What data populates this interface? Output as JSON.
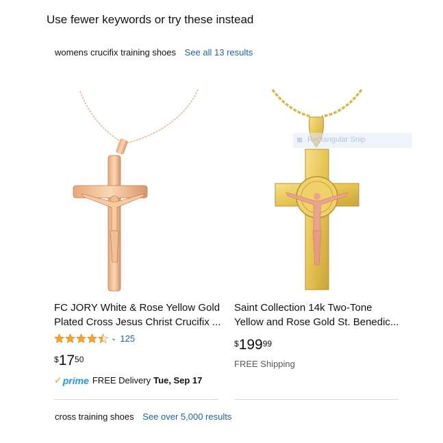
{
  "header": {
    "title": "Use fewer keywords or try these instead"
  },
  "suggestions": [
    {
      "term": "womens crucifix training shoes",
      "link": "See all 13 results"
    },
    {
      "term": "cross training shoes",
      "link": "See over 5,000 results"
    }
  ],
  "products": [
    {
      "title_line1": "FC JORY White & Rose Yellow Gold",
      "title_line2": "Plated Cross Jesus Christ Crucifix ...",
      "rating_stars": 4.5,
      "rating_count": "125",
      "price_currency": "$",
      "price_whole": "17",
      "price_fraction": "50",
      "prime_label": "prime",
      "delivery_text": "FREE Delivery",
      "delivery_date": "Tue, Sep 17",
      "image_icon": "rose-gold-crucifix-necklace"
    },
    {
      "title_line1": "Saint Collection 14k Two-Tone",
      "title_line2": "Yellow and Rose Gold St. Benedic...",
      "price_currency": "$",
      "price_whole": "199",
      "price_fraction": "99",
      "shipping_text": "FREE Shipping",
      "image_icon": "two-tone-gold-crucifix-pendant"
    }
  ],
  "overlay": {
    "snip_label": "Rectangular Snip"
  },
  "colors": {
    "link": "#2162a1",
    "star": "#ffa41c",
    "prime": "#1a98ff",
    "divider": "#d5d9d9"
  }
}
